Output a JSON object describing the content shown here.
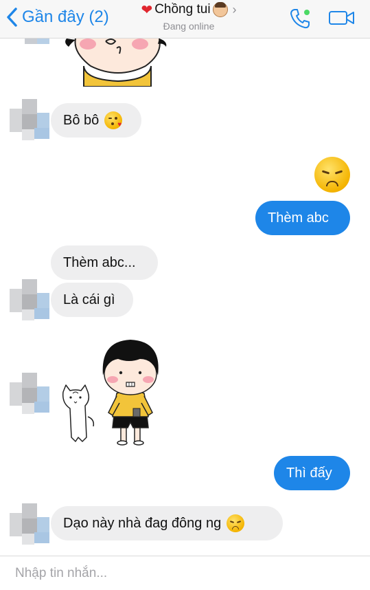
{
  "header": {
    "back_label": "Gần đây (2)",
    "title": "Chồng tui",
    "status": "Đang online",
    "accent": "#1e86e8"
  },
  "messages": [
    {
      "direction": "in",
      "text": "Bô bô"
    },
    {
      "direction": "out",
      "text": "Thèm abc"
    },
    {
      "direction": "in",
      "text": "Thèm abc..."
    },
    {
      "direction": "in",
      "text": "Là cái gì"
    },
    {
      "direction": "out",
      "text": "Thì đấy"
    },
    {
      "direction": "in",
      "text": "Dạo này nhà đag đông ng"
    }
  ],
  "composer": {
    "placeholder": "Nhập tin nhắn..."
  },
  "colors": {
    "incoming_bubble": "#eeeeef",
    "outgoing_bubble": "#1e86e8",
    "header_bg": "#f7f7f7"
  }
}
